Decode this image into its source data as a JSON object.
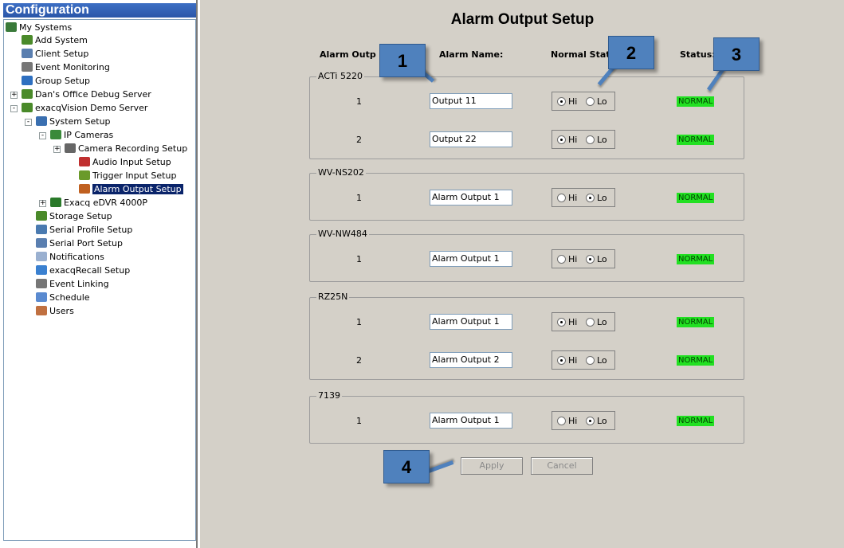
{
  "sidebar": {
    "title": "Configuration",
    "tree": [
      {
        "label": "My Systems",
        "icon": "network-icon",
        "color": "#3a7a3a"
      },
      {
        "label": "Add System",
        "icon": "add-system-icon",
        "color": "#4a8a2a"
      },
      {
        "label": "Client Setup",
        "icon": "client-icon",
        "color": "#5a7fb0"
      },
      {
        "label": "Event Monitoring",
        "icon": "chain-link-icon",
        "color": "#777777"
      },
      {
        "label": "Group Setup",
        "icon": "group-icon",
        "color": "#2e6fc0"
      },
      {
        "label": "Dan's Office Debug Server",
        "icon": "server-icon",
        "color": "#4a8a2a"
      },
      {
        "label": "exacqVision Demo Server",
        "icon": "server-icon",
        "color": "#4a8a2a"
      },
      {
        "label": "System Setup",
        "icon": "system-setup-icon",
        "color": "#3a6fb0"
      },
      {
        "label": "IP Cameras",
        "icon": "ip-camera-icon",
        "color": "#3a8a3a"
      },
      {
        "label": "Camera Recording Setup",
        "icon": "camera-icon",
        "color": "#666666"
      },
      {
        "label": "Audio Input Setup",
        "icon": "speaker-icon",
        "color": "#c03030"
      },
      {
        "label": "Trigger Input Setup",
        "icon": "trigger-icon",
        "color": "#6a9a2a"
      },
      {
        "label": "Alarm Output Setup",
        "icon": "alarm-output-icon",
        "color": "#c06020"
      },
      {
        "label": "Exacq eDVR 4000P",
        "icon": "dvr-icon",
        "color": "#2a7a2a"
      },
      {
        "label": "Storage Setup",
        "icon": "storage-icon",
        "color": "#4a8a2a"
      },
      {
        "label": "Serial Profile Setup",
        "icon": "serial-profile-icon",
        "color": "#4a7ab0"
      },
      {
        "label": "Serial Port Setup",
        "icon": "serial-port-icon",
        "color": "#5a7fb0"
      },
      {
        "label": "Notifications",
        "icon": "envelope-icon",
        "color": "#9ab0d0"
      },
      {
        "label": "exacqRecall Setup",
        "icon": "recall-icon",
        "color": "#3a80d0"
      },
      {
        "label": "Event Linking",
        "icon": "chain-link-icon",
        "color": "#777777"
      },
      {
        "label": "Schedule",
        "icon": "calendar-icon",
        "color": "#5a8ad0"
      },
      {
        "label": "Users",
        "icon": "users-icon",
        "color": "#c07040"
      }
    ]
  },
  "main": {
    "title": "Alarm Output Setup",
    "headers": {
      "output": "Alarm Outp",
      "name": "Alarm Name:",
      "state": "Normal State",
      "status": "Status:"
    },
    "state_labels": {
      "hi": "Hi",
      "lo": "Lo"
    },
    "groups": [
      {
        "label": "ACTi 5220",
        "rows": [
          {
            "num": "1",
            "name": "Output 11",
            "state": "Hi",
            "status": "NORMAL"
          },
          {
            "num": "2",
            "name": "Output 22",
            "state": "Hi",
            "status": "NORMAL"
          }
        ]
      },
      {
        "label": "WV-NS202",
        "rows": [
          {
            "num": "1",
            "name": "Alarm Output 1",
            "state": "Lo",
            "status": "NORMAL"
          }
        ]
      },
      {
        "label": "WV-NW484",
        "rows": [
          {
            "num": "1",
            "name": "Alarm Output 1",
            "state": "Lo",
            "status": "NORMAL"
          }
        ]
      },
      {
        "label": "RZ25N",
        "rows": [
          {
            "num": "1",
            "name": "Alarm Output 1",
            "state": "Hi",
            "status": "NORMAL"
          },
          {
            "num": "2",
            "name": "Alarm Output 2",
            "state": "Hi",
            "status": "NORMAL"
          }
        ]
      },
      {
        "label": "7139",
        "rows": [
          {
            "num": "1",
            "name": "Alarm Output 1",
            "state": "Lo",
            "status": "NORMAL"
          }
        ]
      }
    ],
    "apply_label": "Apply",
    "cancel_label": "Cancel",
    "callouts": [
      "1",
      "2",
      "3",
      "4"
    ],
    "status_color": "#22e022",
    "callout_color": "#4f81bd"
  }
}
